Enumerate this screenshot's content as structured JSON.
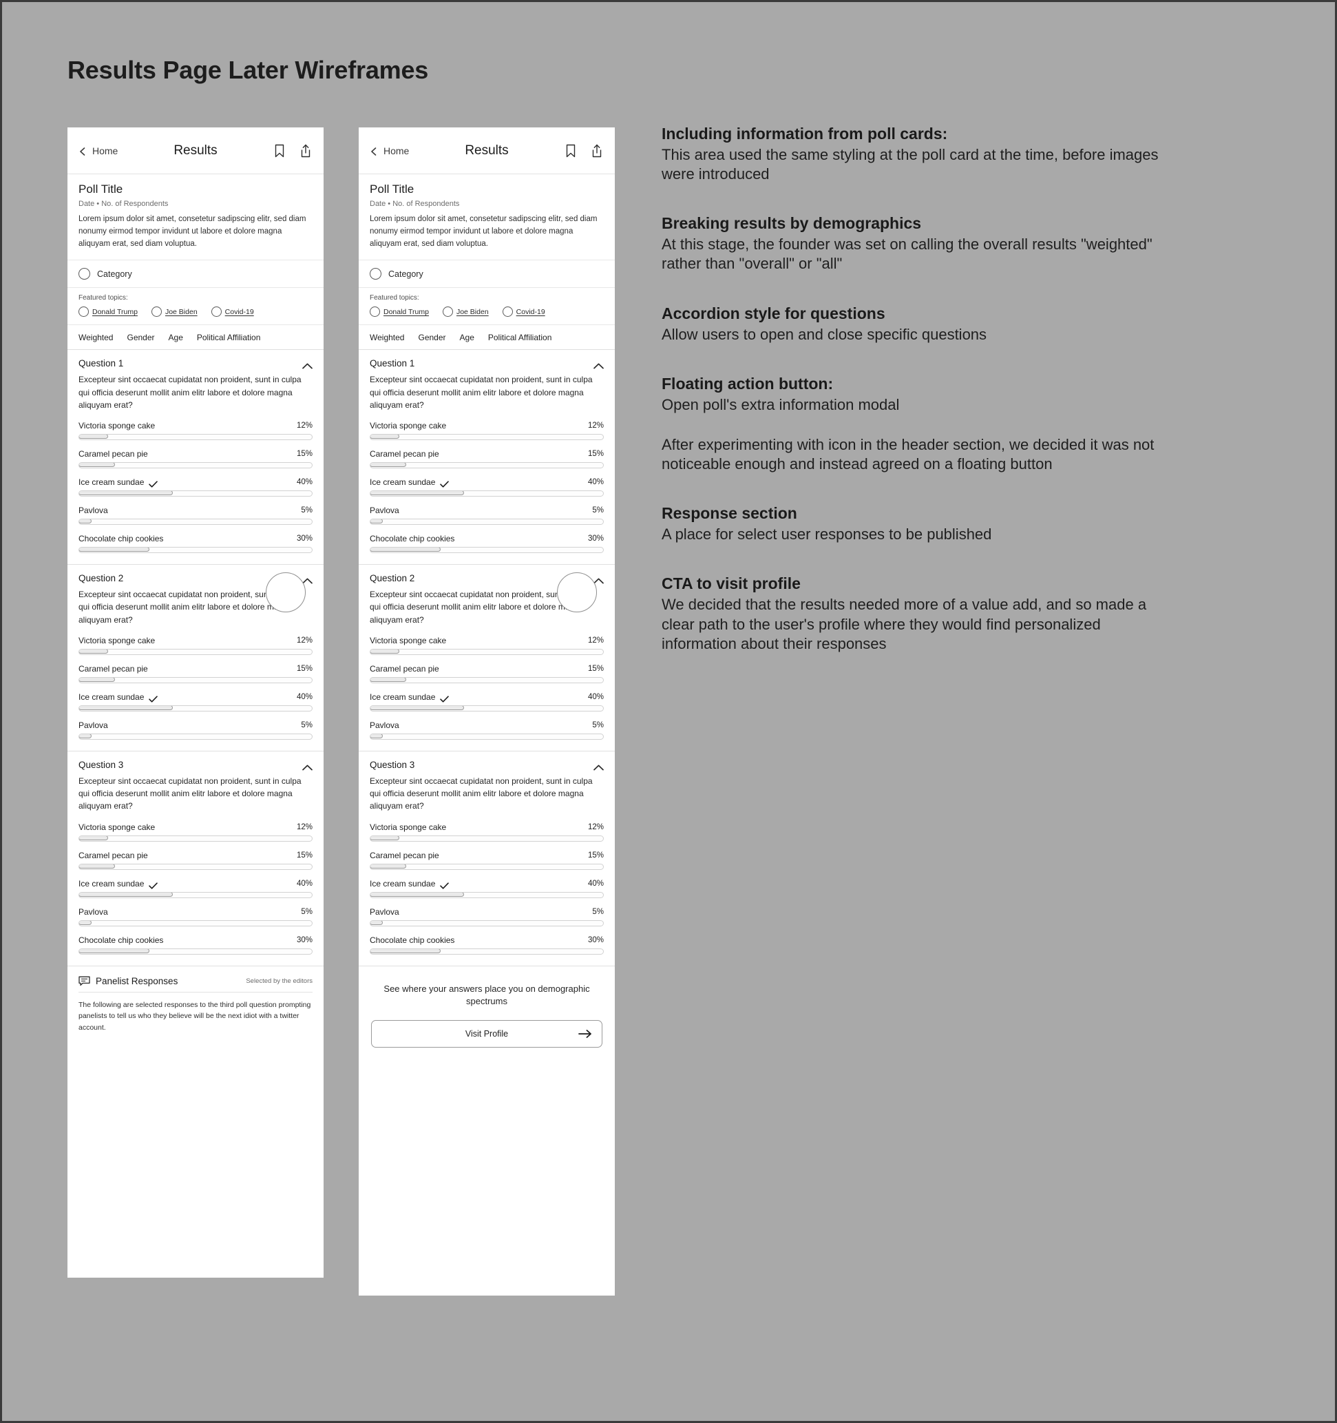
{
  "page": {
    "title": "Results Page Later Wireframes",
    "background_color": "#a9a9a9"
  },
  "phone": {
    "header": {
      "back_label": "Home",
      "title": "Results",
      "back_icon": "chevron-left-icon",
      "bookmark_icon": "bookmark-icon",
      "share_icon": "share-icon"
    },
    "poll": {
      "title": "Poll Title",
      "meta": "Date  •  No. of Respondents",
      "description": "Lorem ipsum dolor sit amet, consetetur sadipscing elitr, sed diam nonumy eirmod tempor invidunt ut labore et dolore magna aliquyam erat, sed diam voluptua."
    },
    "category": {
      "label": "Category"
    },
    "topics": {
      "label": "Featured topics:",
      "items": [
        {
          "name": "Donald Trump"
        },
        {
          "name": "Joe Biden"
        },
        {
          "name": "Covid-19"
        }
      ]
    },
    "demographic_tabs": [
      {
        "label": "Weighted"
      },
      {
        "label": "Gender"
      },
      {
        "label": "Age"
      },
      {
        "label": "Political Affiliation"
      }
    ],
    "questions": [
      {
        "label": "Question 1",
        "text": "Excepteur sint occaecat cupidatat non proident, sunt in culpa qui officia deserunt mollit anim elitr labore et dolore magna aliquyam erat?",
        "answers": [
          {
            "label": "Victoria sponge cake",
            "percent": "12%",
            "value": 12,
            "checked": false
          },
          {
            "label": "Caramel pecan pie",
            "percent": "15%",
            "value": 15,
            "checked": false
          },
          {
            "label": "Ice cream sundae",
            "percent": "40%",
            "value": 40,
            "checked": true
          },
          {
            "label": "Pavlova",
            "percent": "5%",
            "value": 5,
            "checked": false
          },
          {
            "label": "Chocolate chip cookies",
            "percent": "30%",
            "value": 30,
            "checked": false
          }
        ]
      },
      {
        "label": "Question 2",
        "text": "Excepteur sint occaecat cupidatat non proident, sunt in culpa qui officia deserunt mollit anim elitr labore et dolore magna aliquyam erat?",
        "answers": [
          {
            "label": "Victoria sponge cake",
            "percent": "12%",
            "value": 12,
            "checked": false
          },
          {
            "label": "Caramel pecan pie",
            "percent": "15%",
            "value": 15,
            "checked": false
          },
          {
            "label": "Ice cream sundae",
            "percent": "40%",
            "value": 40,
            "checked": true
          },
          {
            "label": "Pavlova",
            "percent": "5%",
            "value": 5,
            "checked": false
          }
        ]
      },
      {
        "label": "Question 3",
        "text": "Excepteur sint occaecat cupidatat non proident, sunt in culpa qui officia deserunt mollit anim elitr labore et dolore magna aliquyam erat?",
        "answers": [
          {
            "label": "Victoria sponge cake",
            "percent": "12%",
            "value": 12,
            "checked": false
          },
          {
            "label": "Caramel pecan pie",
            "percent": "15%",
            "value": 15,
            "checked": false
          },
          {
            "label": "Ice cream sundae",
            "percent": "40%",
            "value": 40,
            "checked": true
          },
          {
            "label": "Pavlova",
            "percent": "5%",
            "value": 5,
            "checked": false
          },
          {
            "label": "Chocolate chip cookies",
            "percent": "30%",
            "value": 30,
            "checked": false
          }
        ]
      }
    ],
    "panelist": {
      "title": "Panelist Responses",
      "note": "Selected by the editors",
      "body": "The following are selected responses to the third poll question prompting panelists to tell us who they believe will be the next idiot with a twitter account."
    },
    "cta": {
      "text": "See where your answers place you on demographic spectrums",
      "button_label": "Visit Profile"
    }
  },
  "annotations": [
    {
      "title": "Including information from poll cards:",
      "body": "This area used the same styling at the poll card at the time, before images were introduced"
    },
    {
      "title": "Breaking results by demographics",
      "body": "At this stage, the founder was set on calling the overall results \"weighted\" rather than \"overall\" or \"all\""
    },
    {
      "title": "Accordion style for questions",
      "body": "Allow users to open and close specific questions"
    },
    {
      "title": "Floating action button:",
      "body": "Open poll's extra information modal",
      "body2": "After experimenting with icon in the header section, we decided it was not noticeable enough and instead agreed on a floating button"
    },
    {
      "title": "Response section",
      "body": "A place for select user responses to be published"
    },
    {
      "title": "CTA to visit profile",
      "body": "We decided that the results needed more of a value add, and so made a clear path to the user's profile where they would find personalized information about their responses"
    }
  ]
}
